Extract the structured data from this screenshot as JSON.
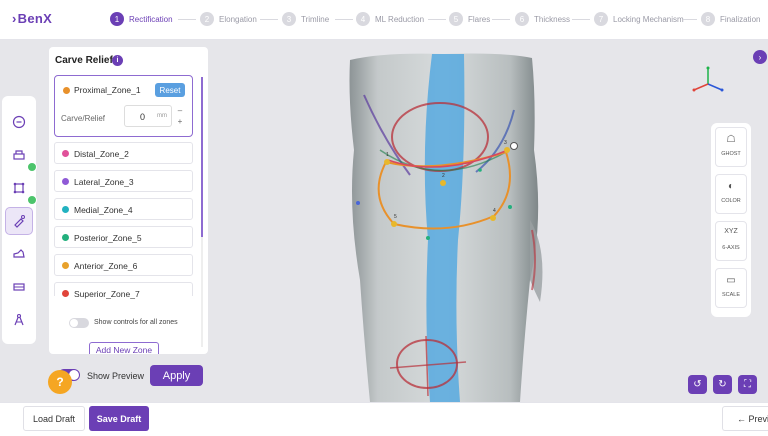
{
  "app": {
    "logo": "BenX"
  },
  "steps": [
    {
      "num": "1",
      "label": "Rectification"
    },
    {
      "num": "2",
      "label": "Elongation"
    },
    {
      "num": "3",
      "label": "Trimline"
    },
    {
      "num": "4",
      "label": "ML Reduction"
    },
    {
      "num": "5",
      "label": "Flares"
    },
    {
      "num": "6",
      "label": "Thickness"
    },
    {
      "num": "7",
      "label": "Locking Mechanism"
    },
    {
      "num": "8",
      "label": "Finalization"
    }
  ],
  "panel": {
    "title": "Carve Relief",
    "active_zone": {
      "name": "Proximal_Zone_1",
      "color": "#e8912b",
      "reset_label": "Reset",
      "carve_label": "Carve/Relief",
      "value": "0",
      "unit": "mm"
    },
    "zones": [
      {
        "name": "Distal_Zone_2",
        "color": "#e0519a"
      },
      {
        "name": "Lateral_Zone_3",
        "color": "#8f5ad6"
      },
      {
        "name": "Medial_Zone_4",
        "color": "#22b2c0"
      },
      {
        "name": "Posterior_Zone_5",
        "color": "#23b07d"
      },
      {
        "name": "Anterior_Zone_6",
        "color": "#e8a12b"
      },
      {
        "name": "Superior_Zone_7",
        "color": "#e0443a"
      }
    ],
    "show_controls_label": "Show controls for all zones",
    "add_zone_label": "Add New Zone"
  },
  "preview": {
    "label": "Show Preview",
    "enabled": true
  },
  "apply_label": "Apply",
  "help_label": "?",
  "right_tools": [
    {
      "icon": "ghost-icon",
      "label": "GHOST",
      "glyph": "☖"
    },
    {
      "icon": "contrast-icon",
      "label": "COLOR",
      "glyph": "◐"
    },
    {
      "icon": "axis-icon",
      "label": "6-AXIS",
      "glyph": "XYZ"
    },
    {
      "icon": "scale-icon",
      "label": "SCALE",
      "glyph": "▭"
    }
  ],
  "footer": {
    "load_label": "Load Draft",
    "save_label": "Save Draft",
    "prev_label": "← Previous"
  },
  "colors": {
    "accent": "#6b3fb5",
    "reset": "#5a9fe0",
    "help": "#f5a623"
  }
}
